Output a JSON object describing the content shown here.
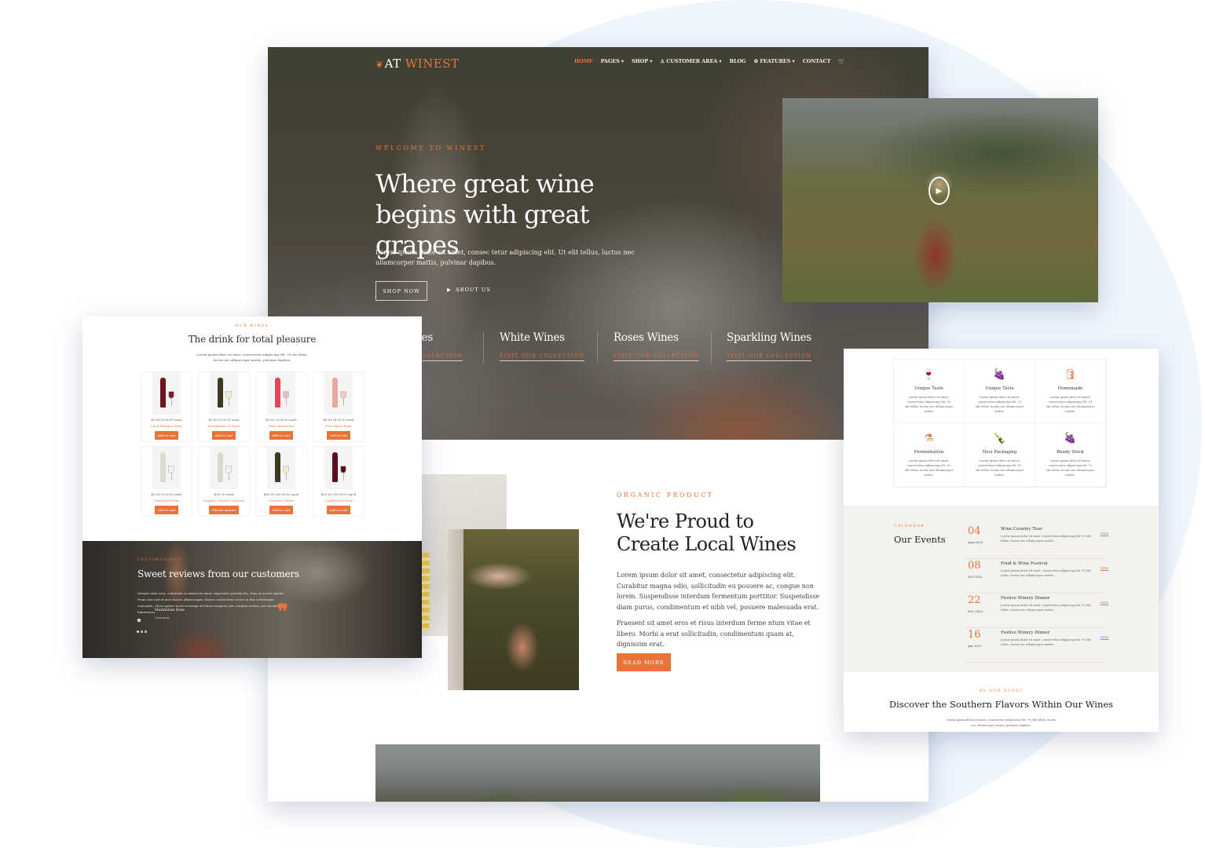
{
  "brand": {
    "logo_prefix": "AT",
    "logo_accent": "WINEST",
    "accent_color": "#e8743a"
  },
  "nav": {
    "items": [
      {
        "label": "HOME",
        "active": true
      },
      {
        "label": "PAGES ▾"
      },
      {
        "label": "SHOP ▾"
      },
      {
        "label": "♙ CUSTOMER AREA ▾"
      },
      {
        "label": "BLOG"
      },
      {
        "label": "⚙ FEATURES ▾"
      },
      {
        "label": "CONTACT"
      },
      {
        "label": "🛒"
      }
    ]
  },
  "hero": {
    "eyebrow": "WELCOME TO WINEST",
    "title": "Where great wine begins with great grapes",
    "description": "Lorem ipsum dolor sit amet, consec tetur adipiscing elit. Ut elit tellus, luctus nec ullamcorper mattis, pulvinar dapibus.",
    "shop_button": "SHOP NOW",
    "about_button": "ABOUT US",
    "collections": [
      {
        "title": "Red Wines",
        "link": "VISIT OUR COLLECTION"
      },
      {
        "title": "White Wines",
        "link": "VISIT OUR COLLECTION"
      },
      {
        "title": "Roses Wines",
        "link": "VISIT OUR COLLECTION"
      },
      {
        "title": "Sparkling Wines",
        "link": "VISIT OUR COLLECTION"
      }
    ]
  },
  "organic": {
    "eyebrow": "ORGANIC PRODUCT",
    "title": "We're Proud to Create Local Wines",
    "paragraph1": "Lorem ipsum dolor sit amet, consectetur adipiscing elit. Curabitur magna odio, sollicitudin eu posuere ac, congue non lorem. Suspendisse interdum fermentum porttitor. Suspendisse diam purus, condimentum et nibh vel, posuere malesuada erat.",
    "paragraph2": "Praesent sit amet eros et risus interdum ferme ntum vitae et libero. Morbi a erat sollicitudin, condimentum quam at, dignissim erat.",
    "button": "READ MORE"
  },
  "video": {
    "play_icon": "▶"
  },
  "wines": {
    "eyebrow": "OUR WINES",
    "title": "The drink for total pleasure",
    "description": "Lorem ipsum dolor sit amet, consectetur adipiscing elit. Ut elit tellus, luctus nec ullamcorper mattis, pulvinar dapibus.",
    "products": [
      {
        "price": "$5.00 (5.00 €) each",
        "name": "Loud Whisper Wine",
        "button": "Add to cart",
        "bottle": "#6e1420",
        "glass": "#7a1a22"
      },
      {
        "price": "$5.00 (5.00 €) each",
        "name": "Bourgandes & Wine",
        "button": "Add to cart",
        "bottle": "#3e3a22",
        "glass": "#f2edc8"
      },
      {
        "price": "$5.00 (5.00 €) each",
        "name": "Wine Adventure",
        "button": "Add to cart",
        "bottle": "#e0485a",
        "glass": "#f2b5b8"
      },
      {
        "price": "$8.00 (8.00 €) each",
        "name": "Free Spirit Wine",
        "button": "Add to cart",
        "bottle": "#e7a9a4",
        "glass": "#f1c7bf"
      },
      {
        "price": "$5.00 (5.00 €) each",
        "name": "Cherryleaf Wine",
        "button": "Add to cart",
        "bottle": "#d9dcd2",
        "glass": "#f4f2e6"
      },
      {
        "price": "$30.00 each",
        "name": "Stephen Vincent Crimson",
        "button": "Choose options",
        "bottle": "#d6d9cf",
        "glass": "#f4f2e6"
      },
      {
        "price": "$65.00 (65.00 €) each",
        "name": "Chamber Bottle",
        "button": "Add to cart",
        "bottle": "#3e3a22",
        "glass": "#f2edc8"
      },
      {
        "price": "$92.00 (92.00 €) each",
        "name": "Copperhead Wine",
        "button": "Add to cart",
        "bottle": "#5c0f1c",
        "glass": "#5a0f18"
      }
    ]
  },
  "testimonials": {
    "eyebrow": "TESTIMONIALS",
    "title": "Sweet reviews from our customers",
    "body": "Integer urna eros, commodo in massa sit amet, imperdiet gravida leo. Duis at iaculis ipsum. Proin non nisl id arcu luctus ullamcorper. Donec consectetur tortor in dui scelerisque venenatis. Class aptent taciti sociosqu ad litora torquent per conubia nostra, per inceptos himenaeos.",
    "author": "Maximilian Rose",
    "role": "Customer",
    "quote_icon": "❞"
  },
  "features": {
    "items": [
      {
        "icon": "🍷",
        "title": "Unique Taste",
        "text": "Lorem ipsum dolor sit amet, consectetur adipiscing elit. Ut elit tellus, luctus nec ullamcorper mattis."
      },
      {
        "icon": "🍇",
        "title": "Unique Taste",
        "text": "Lorem ipsum dolor sit amet, consectetur adipiscing elit. Ut elit tellus, luctus nec ullamcorper mattis."
      },
      {
        "icon": "🛢",
        "title": "Homemade",
        "text": "Lorem ipsum dolor sit amet, consectetur adipiscing elit. Ut elit tellus, luctus nec ullamcorper mattis."
      },
      {
        "icon": "⚗",
        "title": "Fermentation",
        "text": "Lorem ipsum dolor sit amet, consectetur adipiscing elit. Ut elit tellus, luctus nec ullamcorper mattis."
      },
      {
        "icon": "🍾",
        "title": "Nice Packaging",
        "text": "Lorem ipsum dolor sit amet, consectetur adipiscing elit. Ut elit tellus, luctus nec ullamcorper mattis."
      },
      {
        "icon": "🍇",
        "title": "Ready Stock",
        "text": "Lorem ipsum dolor sit amet, consectetur adipiscing elit. Ut elit tellus, luctus nec ullamcorper mattis."
      }
    ]
  },
  "events": {
    "eyebrow": "CALENDAR",
    "title": "Our Events",
    "items": [
      {
        "day": "04",
        "month": "Aug 2022",
        "title": "Wine Country Tour",
        "text": "Lorem ipsum dolor sit amet, consectetur adipiscing elit. Ut elit tellus, luctus nec ullamcorper mattis.",
        "link": "FREE"
      },
      {
        "day": "08",
        "month": "Oct 2022",
        "title": "Food & Wine Festival",
        "text": "Lorem ipsum dolor sit amet, consectetur adipiscing elit. Ut elit tellus, luctus nec ullamcorper mattis.",
        "link": "FREE"
      },
      {
        "day": "22",
        "month": "Dec 2022",
        "title": "Festive Winery Dinner",
        "text": "Lorem ipsum dolor sit amet, consectetur adipiscing elit. Ut elit tellus, luctus nec ullamcorper mattis.",
        "link": "FREE"
      },
      {
        "day": "16",
        "month": "Jan 2023",
        "title": "Festive Winery Dinner",
        "text": "Lorem ipsum dolor sit amet, consectetur adipiscing elit. Ut elit tellus, luctus nec ullamcorper mattis.",
        "link": "FREE"
      }
    ]
  },
  "guest": {
    "eyebrow": "BE OUR GUEST",
    "title": "Discover the Southern Flavors Within Our Wines",
    "description": "Lorem ipsum dolor sit amet, consectetur adipiscing elit. Ut elit tellus, luctus nec ullamcorper mattis, pulvinar dapibus."
  }
}
